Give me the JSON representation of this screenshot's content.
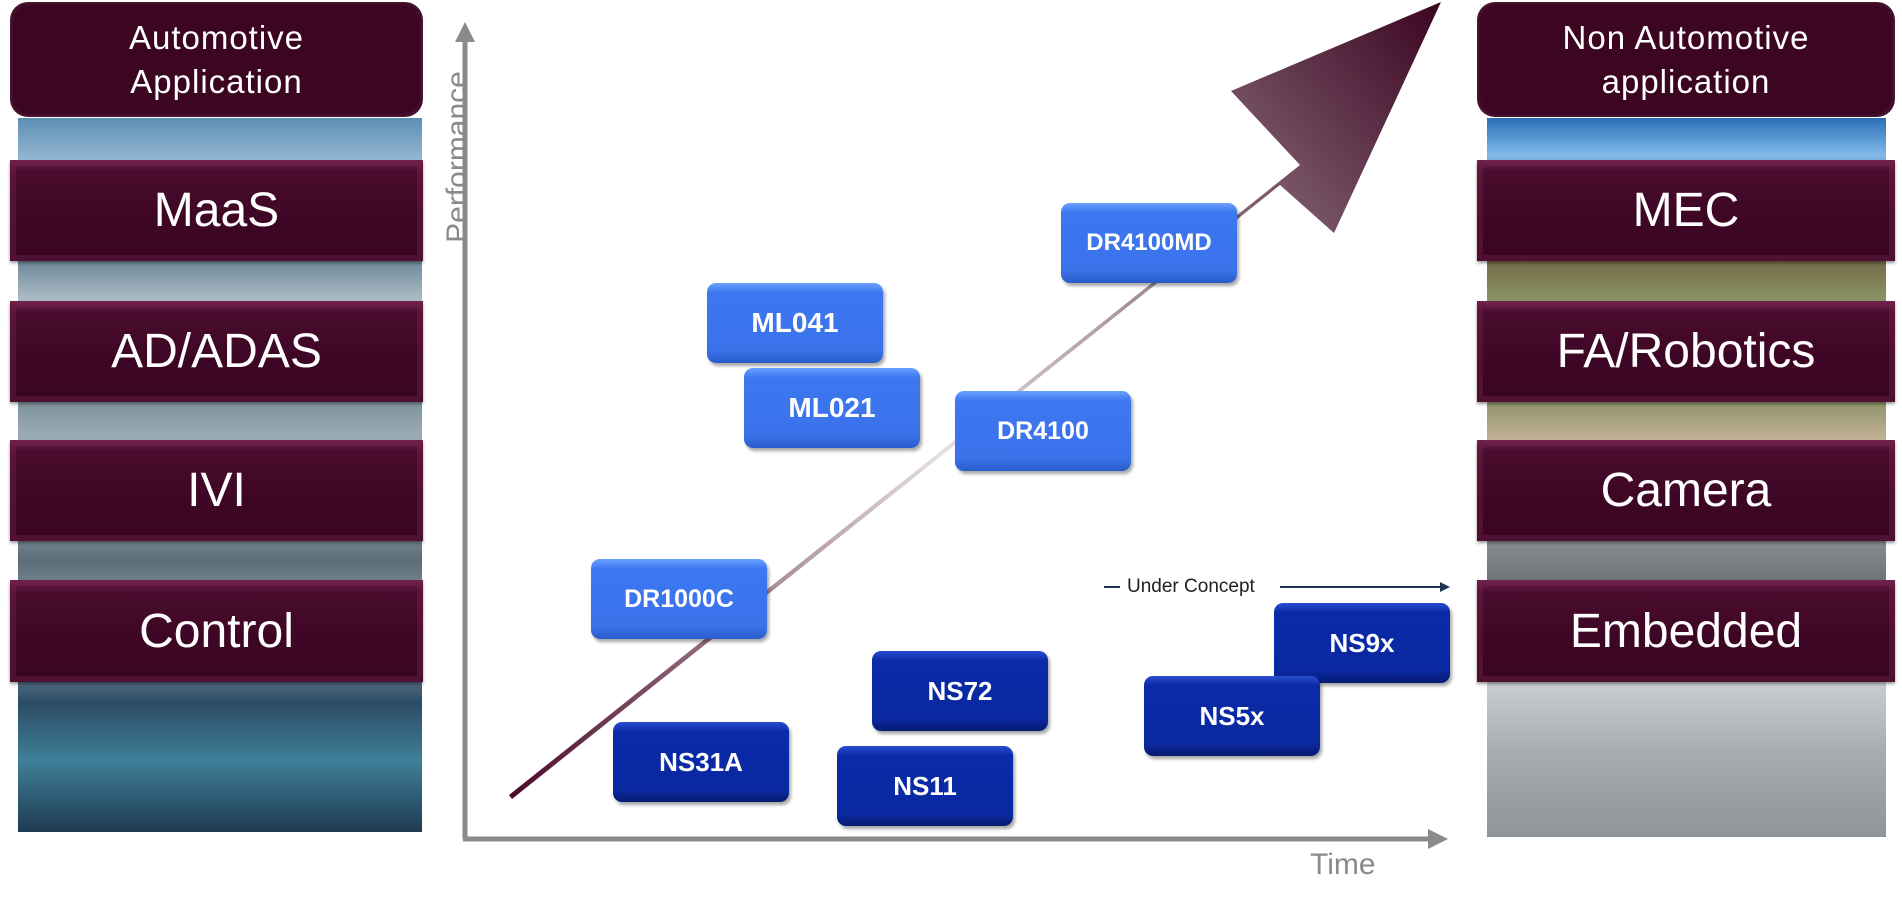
{
  "left": {
    "header": "Automotive Application",
    "bands": [
      "MaaS",
      "AD/ADAS",
      "IVI",
      "Control"
    ]
  },
  "right": {
    "header_line1": "Non Automotive",
    "header_line2": "application",
    "bands": [
      "MEC",
      "FA/Robotics",
      "Camera",
      "Embedded"
    ]
  },
  "axes": {
    "y_label": "Performance",
    "x_label": "Time"
  },
  "under_concept": "Under Concept",
  "chips_light": [
    "ML041",
    "ML021",
    "DR4100MD",
    "DR4100",
    "DR1000C"
  ],
  "chips_dark": [
    "NS31A",
    "NS72",
    "NS11",
    "NS5x",
    "NS9x"
  ],
  "colors": {
    "band": "#3d0624",
    "chip_light": "#3d78f0",
    "chip_dark": "#0a28a0",
    "axis": "#8a8a8a"
  }
}
